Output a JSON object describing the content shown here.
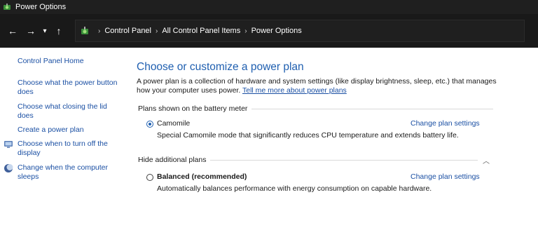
{
  "window": {
    "title": "Power Options",
    "icon": "power-options-icon"
  },
  "addressbar": {
    "breadcrumbs": [
      "Control Panel",
      "All Control Panel Items",
      "Power Options"
    ],
    "back_icon": "arrow-left-icon",
    "forward_icon": "arrow-right-icon",
    "recent_icon": "chevron-down-icon",
    "up_icon": "arrow-up-icon"
  },
  "sidebar": {
    "home": "Control Panel Home",
    "items": [
      {
        "label": "Choose what the power button does"
      },
      {
        "label": "Choose what closing the lid does"
      },
      {
        "label": "Create a power plan"
      },
      {
        "label": "Choose when to turn off the display",
        "icon": "display-icon"
      },
      {
        "label": "Change when the computer sleeps",
        "icon": "moon-icon"
      }
    ]
  },
  "main": {
    "heading": "Choose or customize a power plan",
    "intro": "A power plan is a collection of hardware and system settings (like display brightness, sleep, etc.) that manages how your computer uses power.",
    "intro_link": "Tell me more about power plans",
    "battery_group": "Plans shown on the battery meter",
    "additional_group": "Hide additional plans",
    "plans": [
      {
        "name": "Camomile",
        "selected": true,
        "description": "Special Camomile mode that significantly reduces CPU temperature and extends battery life.",
        "action": "Change plan settings"
      },
      {
        "name": "Balanced (recommended)",
        "selected": false,
        "description": "Automatically balances performance with energy consumption on capable hardware.",
        "action": "Change plan settings"
      }
    ]
  },
  "colors": {
    "accent": "#1f5fb0",
    "link": "#1a4fa3",
    "titlebar": "#1f1f1f"
  }
}
